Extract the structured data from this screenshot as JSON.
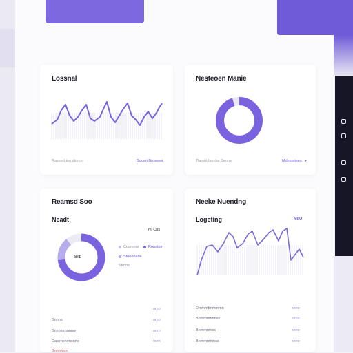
{
  "colors": {
    "accent": "#7b63e0",
    "accent_light": "#b7acec",
    "dark_panel": "#161626",
    "muted_text": "#9a98aa"
  },
  "cards": {
    "line_top": {
      "title": "Lossnal",
      "footer_left": "Raseed ten dinmm",
      "footer_link": "Bomnt Bnseewt"
    },
    "donut_top": {
      "title": "Nesteoen Manie",
      "footer_left": "Tiamnt leenbe Seone",
      "footer_link": "Mdmoatees",
      "footer_link_icon": "chevron-down-icon",
      "percent": 95
    },
    "donut_bottom": {
      "title": "Reamsd Soo",
      "subtitle": "Neadt",
      "side_value": "mi Cns",
      "center_label": "8nb",
      "legend": [
        "Cuanone",
        "Ronstom",
        "Stnnonane",
        "Strnns"
      ],
      "segments": [
        0.73,
        0.16,
        0.11
      ],
      "rows": [
        {
          "label": "Bnnns",
          "value": "omo"
        },
        {
          "label": "Bneoesnonow",
          "value": "oom"
        },
        {
          "label": "Dawrnsnenoons",
          "value": "oom"
        },
        {
          "label": "Srenonsn",
          "value": "oom"
        }
      ],
      "rows_header_value": "omo"
    },
    "line_bottom": {
      "title": "Neeke Nuendng",
      "subtitle": "Logeting",
      "side_value": "MdO",
      "rows": [
        {
          "label": "Dmmmbnmmmn",
          "value": "omo"
        },
        {
          "label": "Bnmmmnnnss",
          "value": "omo"
        },
        {
          "label": "Bnmmmnss",
          "value": "omo"
        },
        {
          "label": "Bnmmmnmss",
          "value": "omo"
        }
      ]
    }
  },
  "dark_panel": {
    "icons": [
      "sidebar-toggle-icon",
      "menu-icon",
      "copy-icon",
      "copy-icon"
    ]
  }
}
